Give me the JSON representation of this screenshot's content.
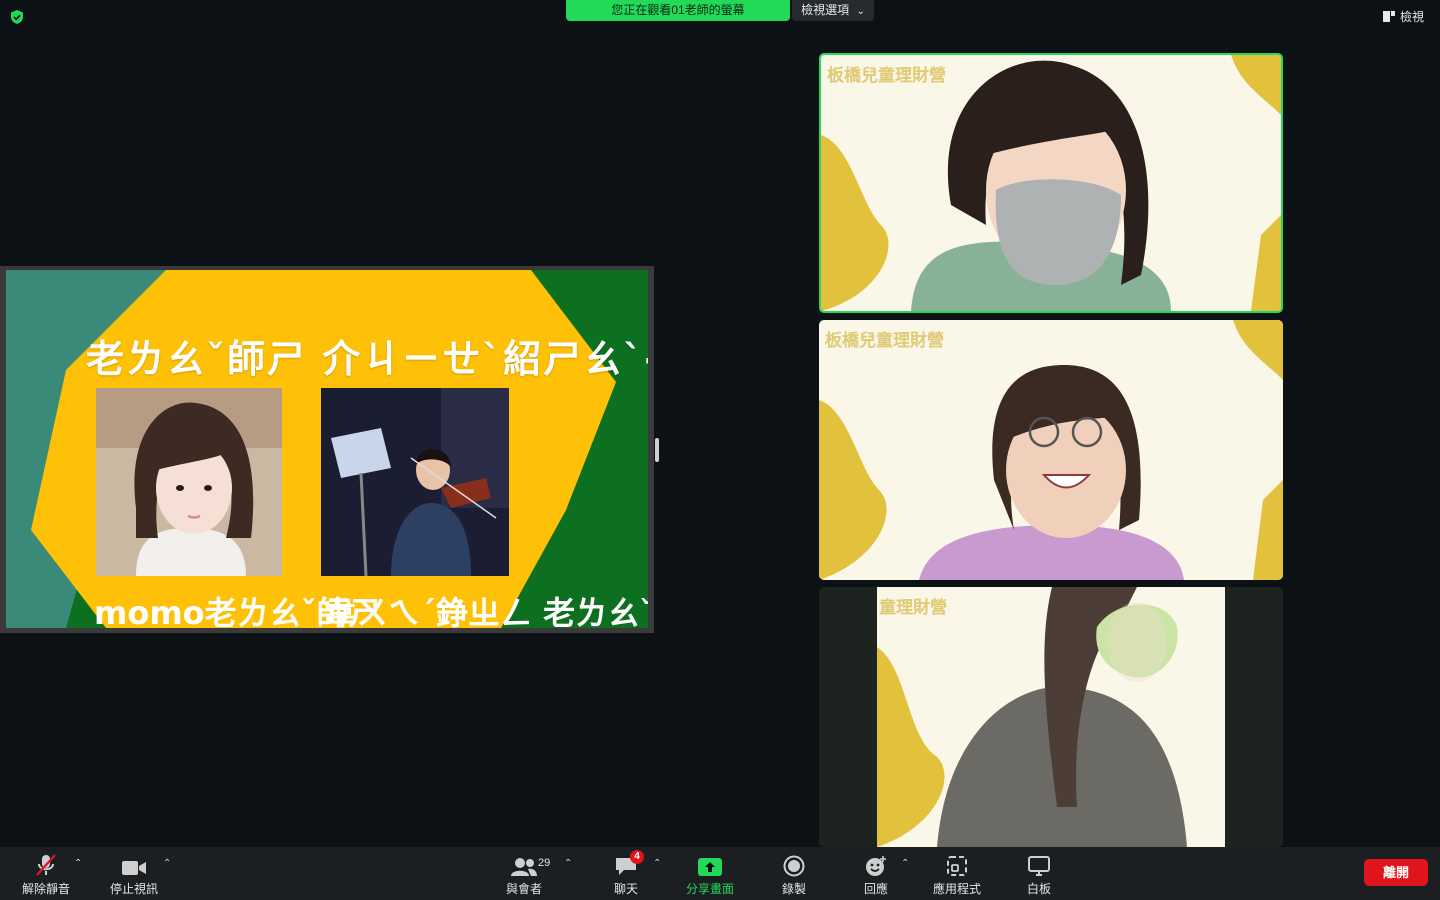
{
  "top_bar": {
    "banner": "您正在觀看01老師的螢幕",
    "view_options": "檢視選項",
    "view": "檢視"
  },
  "slide": {
    "title": "老ㄌㄠˇ師ㄕ 介ㄐㄧㄝˋ紹ㄕㄠˋ-感ㄍㄢˇ恩ㄣ 課ㄎㄜˋ",
    "caption_1": "momo老ㄌㄠˇ師ㄕ",
    "caption_2": "韋ㄨㄟˊ錚ㄓㄥ 老ㄌㄠˇ師ㄕ",
    "colors": {
      "yellow": "#ffc107",
      "teal": "#3a8a7a",
      "green": "#0d7020"
    }
  },
  "videos": [
    {
      "label": "板橋兒童理財營"
    },
    {
      "label": "板橋兒童理財營"
    },
    {
      "label": "童理財營"
    }
  ],
  "toolbar": {
    "unmute": "解除靜音",
    "stop_video": "停止視訊",
    "participants": "與會者",
    "participants_count": "29",
    "chat": "聊天",
    "chat_badge": "4",
    "share_screen": "分享畫面",
    "record": "錄製",
    "reactions": "回應",
    "apps": "應用程式",
    "whiteboard": "白板",
    "leave": "離開"
  }
}
